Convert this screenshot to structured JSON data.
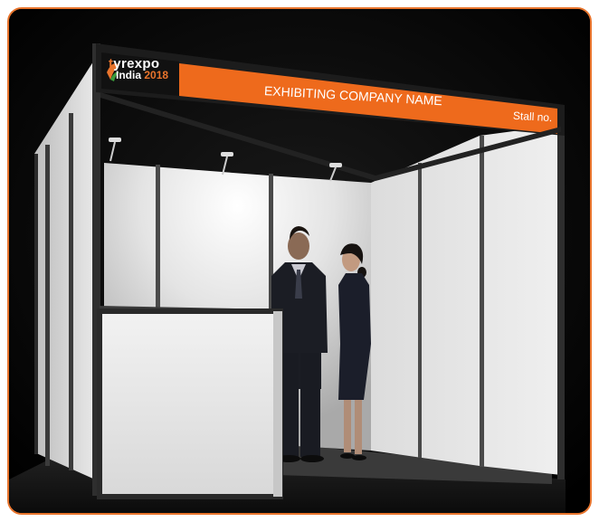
{
  "logo": {
    "brand_prefix": "t",
    "brand_suffix": "yrexpo",
    "line2_text": "India",
    "line2_year": "2018",
    "accent_color": "#e9742c"
  },
  "fascia": {
    "company_name": "EXHIBITING COMPANY NAME",
    "stall_label": "Stall no.",
    "color": "#ee6a1c"
  },
  "frame": {
    "border_color": "#e8742c"
  }
}
